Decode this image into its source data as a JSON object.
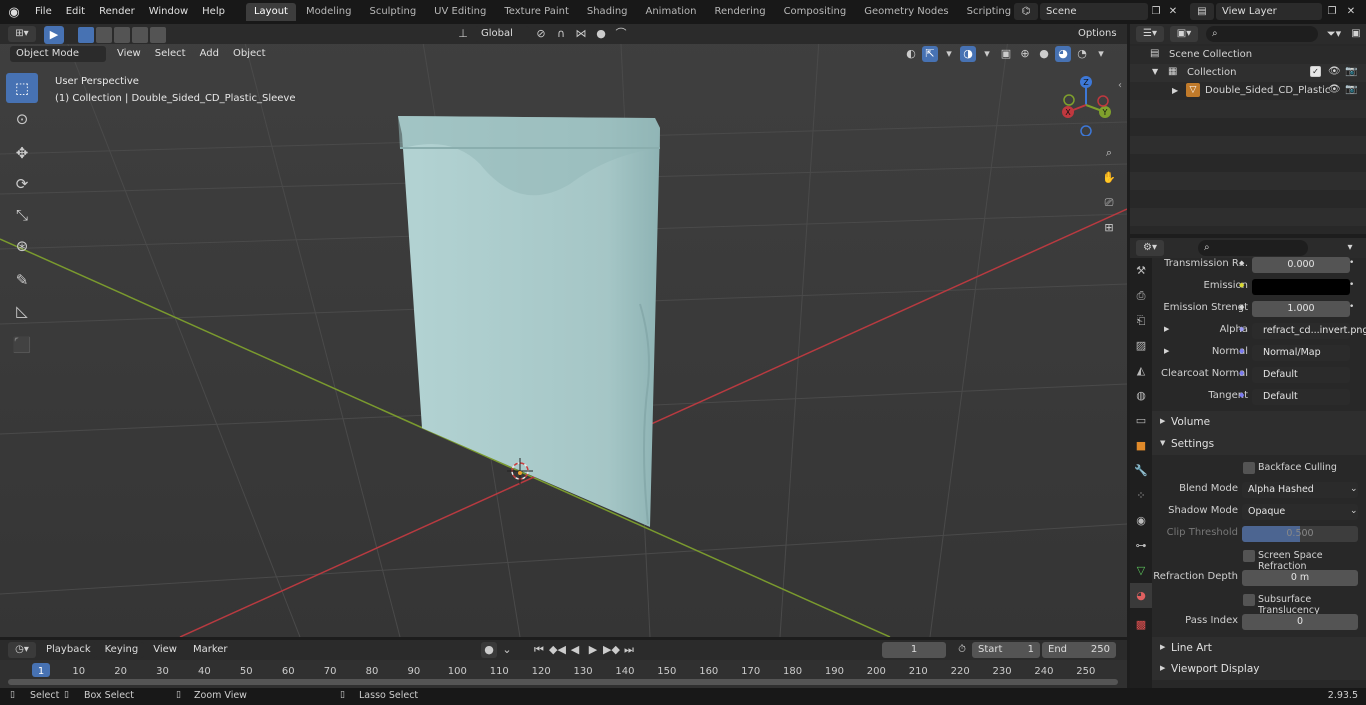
{
  "topbar": {
    "menus": [
      "File",
      "Edit",
      "Render",
      "Window",
      "Help"
    ],
    "workspaces": [
      "Layout",
      "Modeling",
      "Sculpting",
      "UV Editing",
      "Texture Paint",
      "Shading",
      "Animation",
      "Rendering",
      "Compositing",
      "Geometry Nodes",
      "Scripting"
    ],
    "active_workspace": "Layout",
    "scene": "Scene",
    "view_layer": "View Layer"
  },
  "viewport": {
    "mode": "Object Mode",
    "menus": [
      "View",
      "Select",
      "Add",
      "Object"
    ],
    "transform_orientation": "Global",
    "options_label": "Options",
    "perspective_label": "User Perspective",
    "collection_label": "(1) Collection | Double_Sided_CD_Plastic_Sleeve",
    "gizmo": {
      "x": "X",
      "y": "Y",
      "z": "Z"
    }
  },
  "outliner": {
    "scene_collection": "Scene Collection",
    "collection": "Collection",
    "object": "Double_Sided_CD_Plastic"
  },
  "properties": {
    "rows": [
      {
        "label": "Transmission R...",
        "value": "0.000"
      },
      {
        "label": "Emission",
        "value": ""
      },
      {
        "label": "Emission Strengt",
        "value": "1.000"
      },
      {
        "label": "Alpha",
        "value": "refract_cd...invert.png"
      },
      {
        "label": "Normal",
        "value": "Normal/Map"
      },
      {
        "label": "Clearcoat Normal",
        "value": "Default"
      },
      {
        "label": "Tangent",
        "value": "Default"
      }
    ],
    "panel_volume": "Volume",
    "panel_settings": "Settings",
    "backface_culling": "Backface Culling",
    "blend_mode_label": "Blend Mode",
    "blend_mode": "Alpha Hashed",
    "shadow_mode_label": "Shadow Mode",
    "shadow_mode": "Opaque",
    "clip_threshold_label": "Clip Threshold",
    "clip_threshold": "0.500",
    "ssr_label": "Screen Space Refraction",
    "refraction_depth_label": "Refraction Depth",
    "refraction_depth": "0 m",
    "subsurface_label": "Subsurface Translucency",
    "pass_index_label": "Pass Index",
    "pass_index": "0",
    "panel_line_art": "Line Art",
    "panel_viewport_display": "Viewport Display"
  },
  "timeline": {
    "menus": [
      "Playback",
      "Keying",
      "View",
      "Marker"
    ],
    "current_frame": "1",
    "start_label": "Start",
    "start": "1",
    "end_label": "End",
    "end": "250",
    "ruler": [
      "1",
      "10",
      "20",
      "30",
      "40",
      "50",
      "60",
      "70",
      "80",
      "90",
      "100",
      "110",
      "120",
      "130",
      "140",
      "150",
      "160",
      "170",
      "180",
      "190",
      "200",
      "210",
      "220",
      "230",
      "240",
      "250"
    ]
  },
  "statusbar": {
    "select": "Select",
    "box_select": "Box Select",
    "zoom_view": "Zoom View",
    "lasso_select": "Lasso Select",
    "version": "2.93.5"
  },
  "colors": {
    "accent": "#4772b3",
    "sleeve": "#a9c9c9",
    "x_axis": "#c0383f",
    "y_axis": "#7fa02c",
    "z_axis": "#3d78d8"
  }
}
